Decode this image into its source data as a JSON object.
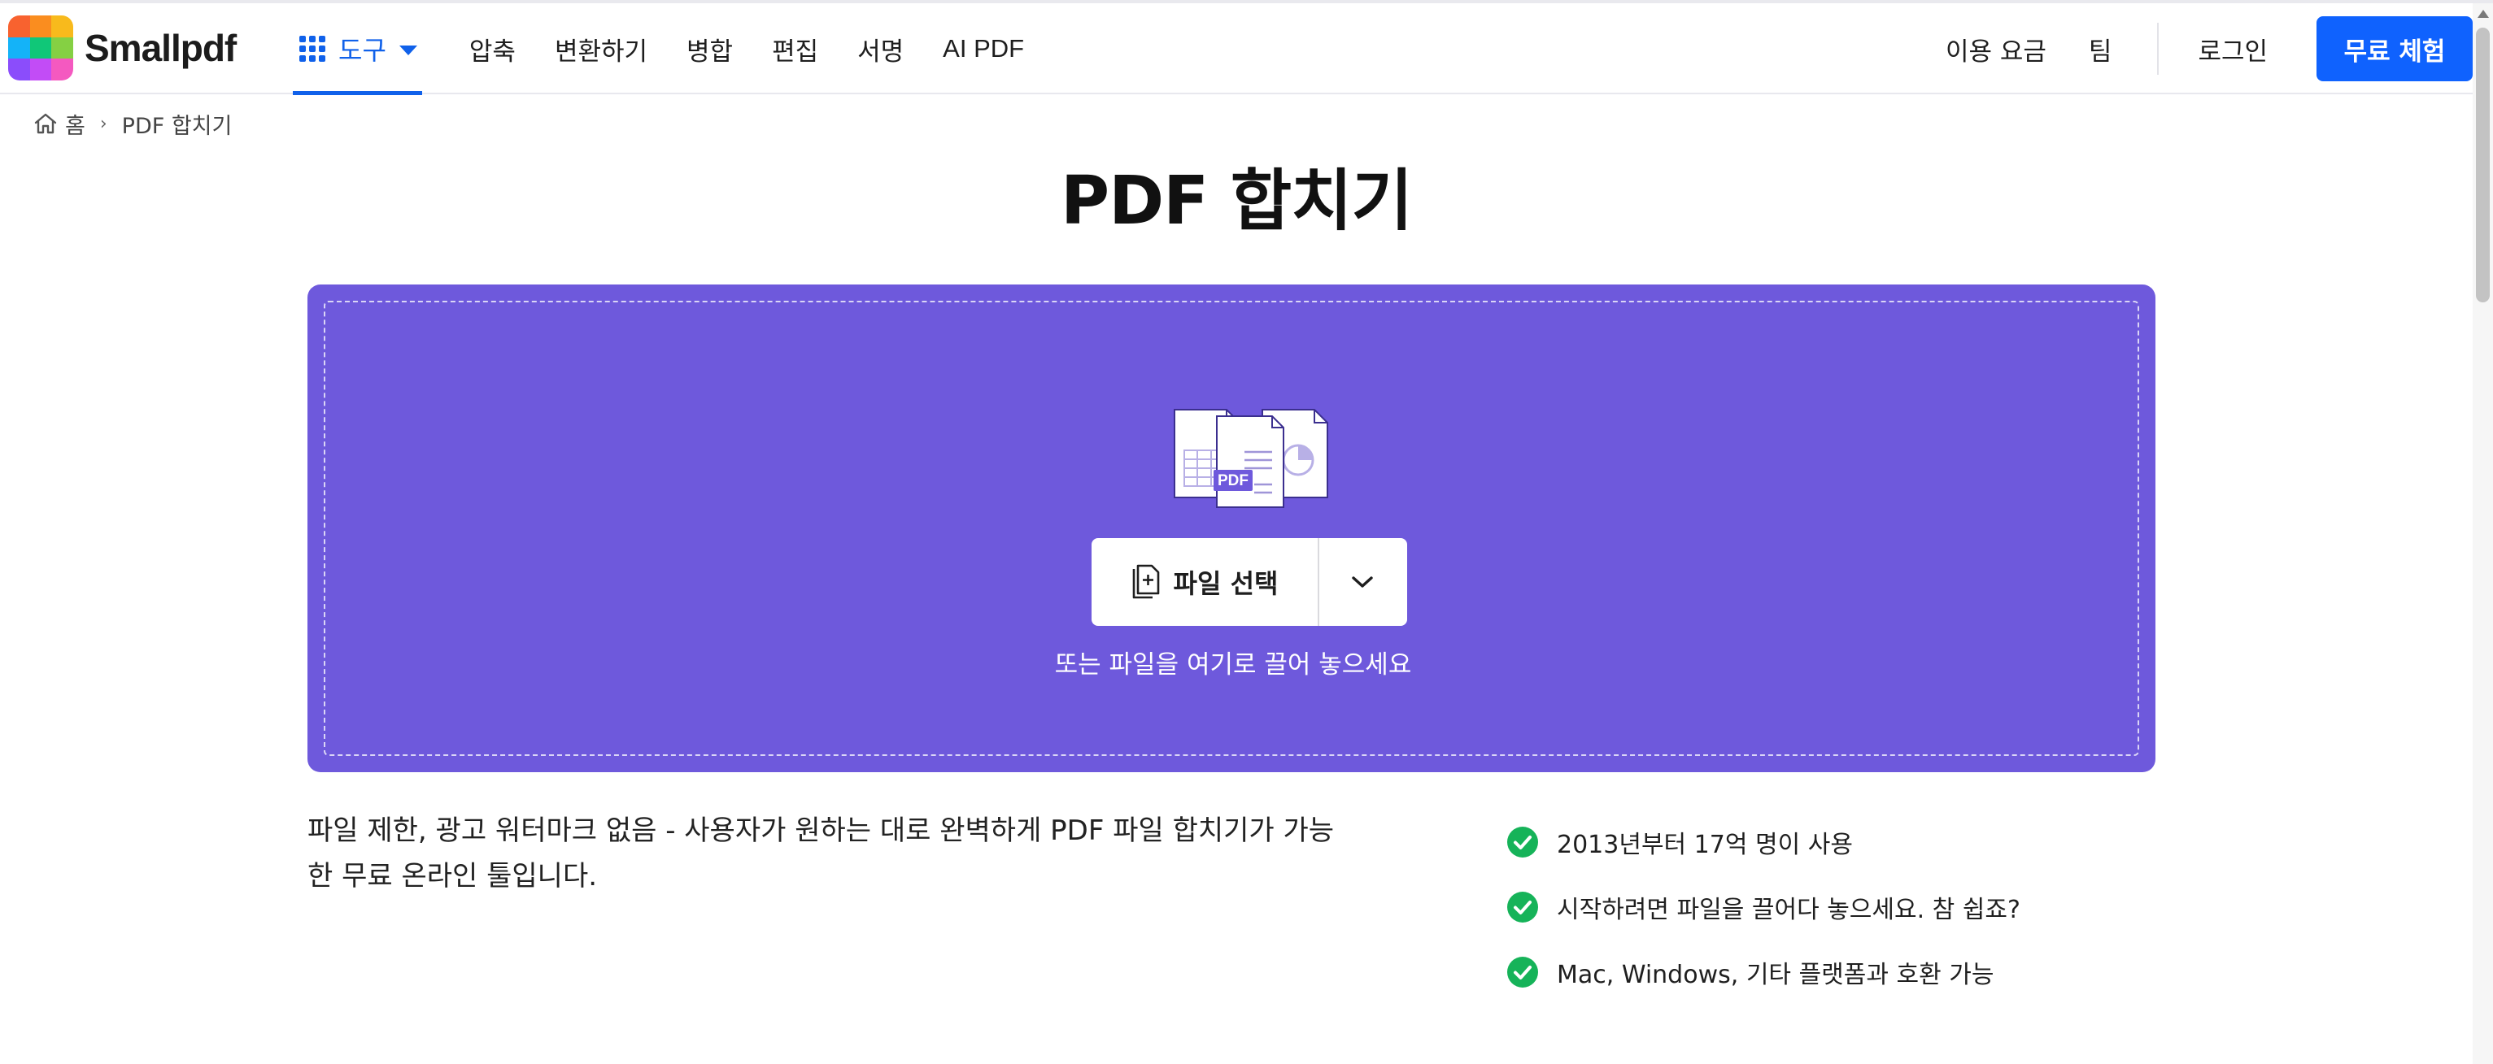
{
  "brand": {
    "name": "Smallpdf",
    "logo_colors": [
      "#f8622f",
      "#fa8d1f",
      "#f8ba1c",
      "#14b3f8",
      "#10c778",
      "#85d043",
      "#8b4dfb",
      "#c24cf6",
      "#f459c0"
    ]
  },
  "header": {
    "tools_label": "도구",
    "nav": [
      "압축",
      "변환하기",
      "병합",
      "편집",
      "서명",
      "AI PDF"
    ],
    "pricing_label": "이용 요금",
    "team_label": "팀",
    "login_label": "로그인",
    "trial_label": "무료 체험"
  },
  "breadcrumb": {
    "home": "홈",
    "separator": "›",
    "current": "PDF 합치기"
  },
  "page_title": "PDF 합치기",
  "dropzone": {
    "illustration_badge": "PDF",
    "choose_button_label": "파일 선택",
    "drop_hint": "또는 파일을 여기로 끌어 놓으세요",
    "background_color": "#6e59dc"
  },
  "description": "파일 제한, 광고 워터마크 없음 - 사용자가 원하는 대로 완벽하게 PDF 파일 합치기가 가능한 무료 온라인 툴입니다.",
  "features": [
    "2013년부터 17억 명이 사용",
    "시작하려면 파일을 끌어다 놓으세요. 참 쉽죠?",
    "Mac, Windows, 기타 플랫폼과 호환 가능"
  ],
  "colors": {
    "accent": "#0f62fe",
    "check": "#16b359"
  },
  "icons": {
    "tools": "grid-icon",
    "dropdown": "chevron-down-icon",
    "home": "home-icon",
    "file": "file-plus-icon",
    "feature": "check-circle-icon"
  }
}
